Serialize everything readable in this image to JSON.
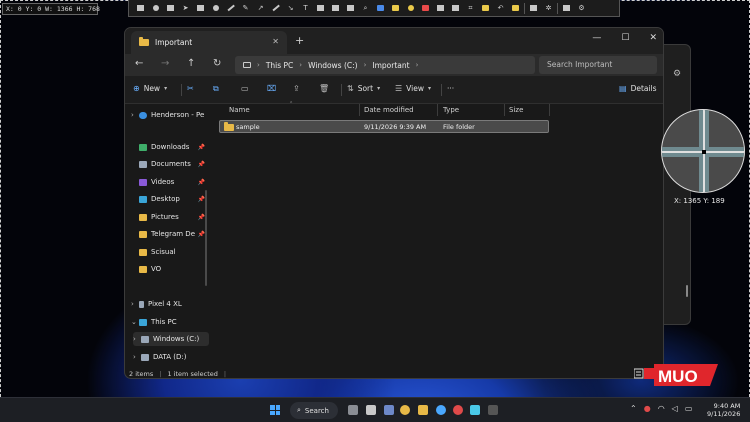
{
  "screen_info": "X: 0 Y: 0 W: 1366 H: 768",
  "explorer": {
    "tab_title": "Important",
    "breadcrumbs": [
      "This PC",
      "Windows (C:)",
      "Important"
    ],
    "search_placeholder": "Search Important",
    "commands": {
      "new": "New",
      "sort": "Sort",
      "view": "View",
      "more": "···",
      "details": "Details"
    },
    "nav_items": [
      {
        "label": "Henderson - Pe",
        "icon": "cloud-icon",
        "pinned": false
      },
      {
        "label": "Downloads",
        "icon": "download-icon",
        "pinned": true
      },
      {
        "label": "Documents",
        "icon": "document-icon",
        "pinned": true
      },
      {
        "label": "Videos",
        "icon": "video-icon",
        "pinned": true
      },
      {
        "label": "Desktop",
        "icon": "desktop-icon",
        "pinned": true
      },
      {
        "label": "Pictures",
        "icon": "pictures-icon",
        "pinned": true
      },
      {
        "label": "Telegram De",
        "icon": "folder-icon",
        "pinned": true
      },
      {
        "label": "Scisual",
        "icon": "folder-icon",
        "pinned": false
      },
      {
        "label": "VO",
        "icon": "folder-icon",
        "pinned": false
      },
      {
        "label": "Pixel 4 XL",
        "icon": "phone-icon",
        "pinned": false
      },
      {
        "label": "This PC",
        "icon": "monitor-icon",
        "pinned": false
      },
      {
        "label": "Windows (C:)",
        "icon": "drive-icon",
        "pinned": false
      },
      {
        "label": "DATA (D:)",
        "icon": "drive-icon",
        "pinned": false
      }
    ],
    "columns": [
      "Name",
      "Date modified",
      "Type",
      "Size"
    ],
    "rows": [
      {
        "name": "sample",
        "date": "9/11/2026 9:39 AM",
        "type": "File folder",
        "size": ""
      }
    ],
    "status": {
      "items": "2 items",
      "selected": "1 item selected"
    }
  },
  "magnifier": {
    "coords": "X: 1365 Y: 189"
  },
  "logo": "MUO",
  "taskbar": {
    "search_label": "Search",
    "time": "9:40 AM",
    "date": "9/11/2026"
  },
  "colors": {
    "accent": "#4aa8ff",
    "folder": "#e8b947",
    "logo_red": "#e0262c"
  }
}
